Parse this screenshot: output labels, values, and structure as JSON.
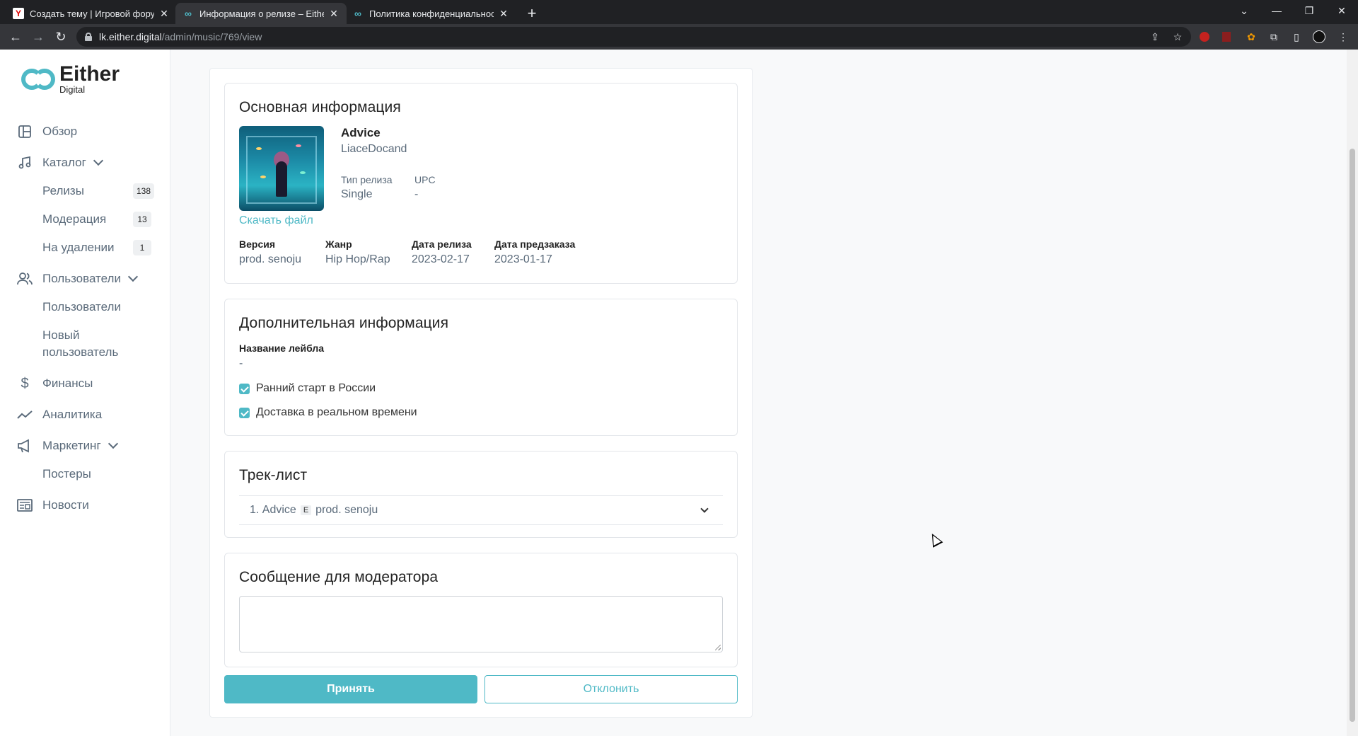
{
  "browser": {
    "tabs": [
      {
        "label": "Создать тему | Игровой форум",
        "favicon": "Y"
      },
      {
        "label": "Информация о релизе – Either Digital",
        "favicon": "∞"
      },
      {
        "label": "Политика конфиденциальности",
        "favicon": "∞"
      }
    ],
    "url_host": "lk.either.digital",
    "url_path": "/admin/music/769/view"
  },
  "brand": {
    "title": "Either",
    "subtitle": "Digital",
    "color": "#4fb9c6"
  },
  "sidebar": {
    "overview": "Обзор",
    "catalog": "Каталог",
    "releases": "Релизы",
    "releases_count": "138",
    "moderation": "Модерация",
    "moderation_count": "13",
    "deletion": "На удалении",
    "deletion_count": "1",
    "users_group": "Пользователи",
    "users": "Пользователи",
    "new_user": "Новый пользователь",
    "finance": "Финансы",
    "analytics": "Аналитика",
    "marketing": "Маркетинг",
    "posters": "Постеры",
    "news": "Новости"
  },
  "basic": {
    "title": "Основная информация",
    "release_name": "Advice",
    "artist": "LiaceDocand",
    "type_label": "Тип релиза",
    "type_value": "Single",
    "upc_label": "UPC",
    "upc_value": "-",
    "download": "Скачать файл",
    "version_label": "Версия",
    "version_value": "prod. senoju",
    "genre_label": "Жанр",
    "genre_value": "Hip Hop/Rap",
    "release_date_label": "Дата релиза",
    "release_date_value": "2023-02-17",
    "preorder_label": "Дата предзаказа",
    "preorder_value": "2023-01-17"
  },
  "extra": {
    "title": "Дополнительная информация",
    "label_name_label": "Название лейбла",
    "label_name_value": "-",
    "early_start": "Ранний старт в России",
    "realtime_delivery": "Доставка в реальном времени"
  },
  "tracklist": {
    "title": "Трек-лист",
    "tracks": [
      {
        "number": "1.",
        "name": "Advice",
        "explicit": "E",
        "version": "prod. senoju"
      }
    ]
  },
  "moderator": {
    "title": "Сообщение для модератора",
    "message": ""
  },
  "actions": {
    "accept": "Принять",
    "reject": "Отклонить"
  }
}
